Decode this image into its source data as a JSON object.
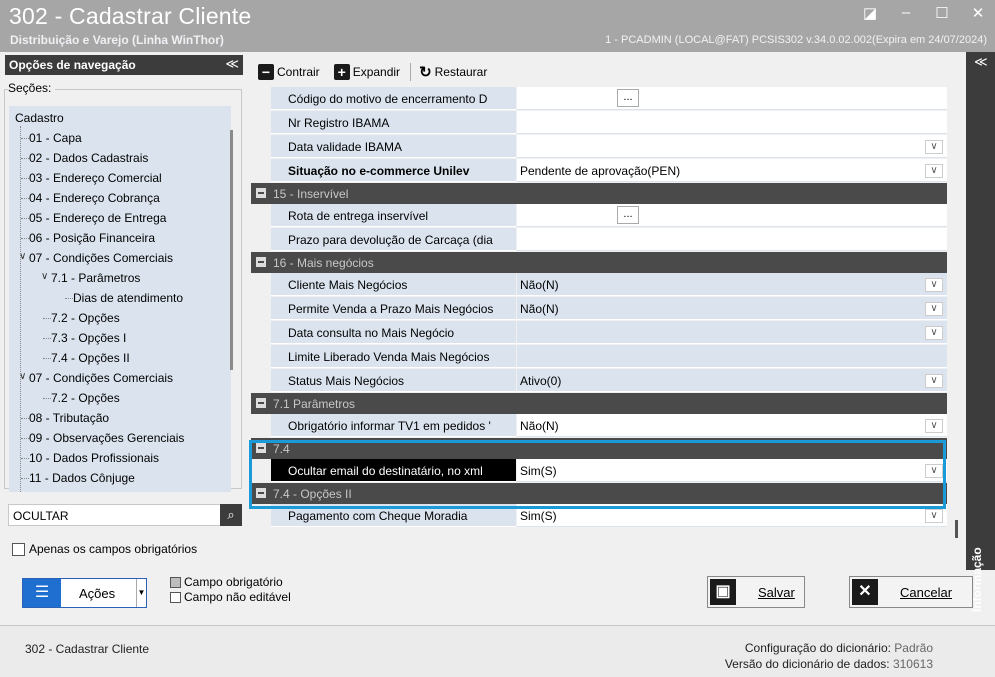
{
  "window": {
    "title": "302 - Cadastrar Cliente",
    "subtitle": "Distribuição e Varejo (Linha WinThor)",
    "session_info": "1 - PCADMIN (LOCAL@FAT)   PCSIS302  v.34.0.02.002(Expira em 24/07/2024)"
  },
  "nav": {
    "header": "Opções de navegação",
    "collapse_glyph": "≪",
    "sections_label": "Seções:",
    "tree": [
      {
        "label": "Cadastro"
      },
      {
        "label": "01 - Capa"
      },
      {
        "label": "02 - Dados Cadastrais"
      },
      {
        "label": "03 - Endereço Comercial"
      },
      {
        "label": "04 - Endereço Cobrança"
      },
      {
        "label": "05 - Endereço de Entrega"
      },
      {
        "label": "06 - Posição Financeira"
      },
      {
        "label": "07 - Condições Comerciais"
      },
      {
        "label": "7.1 - Parâmetros"
      },
      {
        "label": "Dias de atendimento"
      },
      {
        "label": "7.2 - Opções"
      },
      {
        "label": "7.3 - Opções I"
      },
      {
        "label": "7.4 - Opções II"
      },
      {
        "label": "07 - Condições Comerciais"
      },
      {
        "label": "7.2 - Opções"
      },
      {
        "label": "08 - Tributação"
      },
      {
        "label": "09 - Observações Gerenciais"
      },
      {
        "label": "10 - Dados Profissionais"
      },
      {
        "label": "11 - Dados Cônjuge"
      }
    ],
    "search_value": "OCULTAR",
    "required_only_label": "Apenas os campos obrigatórios"
  },
  "toolbar": {
    "collapse_label": "Contrair",
    "expand_label": "Expandir",
    "restore_label": "Restaurar"
  },
  "right_strip": {
    "collapse_glyph": "≪",
    "label": "Informação"
  },
  "grid": {
    "rows": [
      {
        "label": "Código do motivo de encerramento D",
        "value": ""
      },
      {
        "label": "Nr Registro IBAMA",
        "value": ""
      },
      {
        "label": "Data validade IBAMA",
        "value": ""
      },
      {
        "label": "Situação no e-commerce Unilev",
        "value": "Pendente de aprovação(PEN)"
      },
      {
        "group": "15 - Inservível"
      },
      {
        "label": "Rota de entrega inservível",
        "value": ""
      },
      {
        "label": "Prazo para devolução de Carcaça (dia",
        "value": ""
      },
      {
        "group": "16 - Mais negócios"
      },
      {
        "label": "Cliente Mais Negócios",
        "value": "Não(N)"
      },
      {
        "label": "Permite Venda a Prazo Mais Negócios",
        "value": "Não(N)"
      },
      {
        "label": "Data consulta no Mais Negócio",
        "value": ""
      },
      {
        "label": "Limite Liberado Venda Mais Negócios",
        "value": ""
      },
      {
        "label": "Status Mais Negócios",
        "value": "Ativo(0)"
      },
      {
        "group": "7.1 Parâmetros"
      },
      {
        "label": "Obrigatório informar TV1 em pedidos '",
        "value": "Não(N)"
      },
      {
        "group": "7.4"
      },
      {
        "label": "Ocultar email do destinatário, no xml",
        "value": "Sim(S)"
      },
      {
        "group": "7.4 - Opções II"
      },
      {
        "label": "Pagamento com Cheque Moradia",
        "value": "Sim(S)"
      }
    ],
    "ellipsis": "...",
    "dropdown_glyph": "∨"
  },
  "actions": {
    "acoes_label": "Ações",
    "legend_required": "Campo obrigatório",
    "legend_readonly": "Campo não editável",
    "save_label": "Salvar",
    "cancel_label": "Cancelar"
  },
  "status": {
    "left": "302 - Cadastrar Cliente",
    "dict_config_label": "Configuração do dicionário:",
    "dict_config_value": "Padrão",
    "dict_version_label": "Versão do dicionário de dados:",
    "dict_version_value": "310613"
  },
  "colors": {
    "titlebar": "#a6a6a6",
    "panel_dark": "#3c3c3c",
    "row_label_bg": "#dbe4ee",
    "highlight": "#1a9bd8",
    "acoes_blue": "#1e6fd0"
  }
}
